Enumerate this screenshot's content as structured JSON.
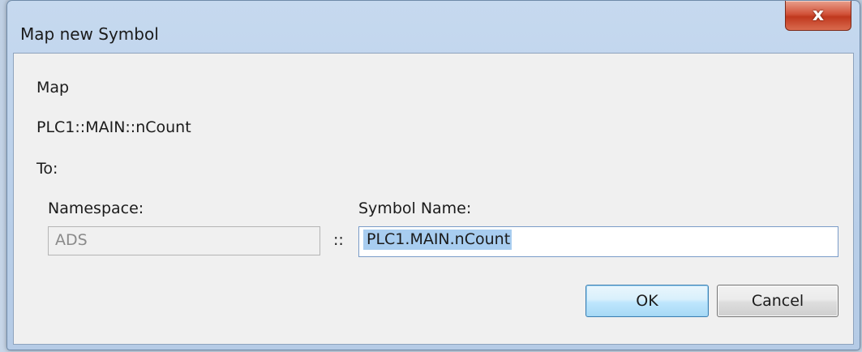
{
  "window": {
    "title": "Map new Symbol",
    "close_glyph": "x"
  },
  "form": {
    "map_label": "Map",
    "source_symbol": "PLC1::MAIN::nCount",
    "to_label": "To:",
    "namespace_label": "Namespace:",
    "namespace_value": "ADS",
    "separator": "::",
    "symbol_name_label": "Symbol Name:",
    "symbol_name_value": "PLC1.MAIN.nCount"
  },
  "buttons": {
    "ok_label": "OK",
    "cancel_label": "Cancel"
  },
  "colors": {
    "selection": "#a8cdf0",
    "close_button": "#c0381e",
    "ok_button_border": "#3c7fb1"
  }
}
